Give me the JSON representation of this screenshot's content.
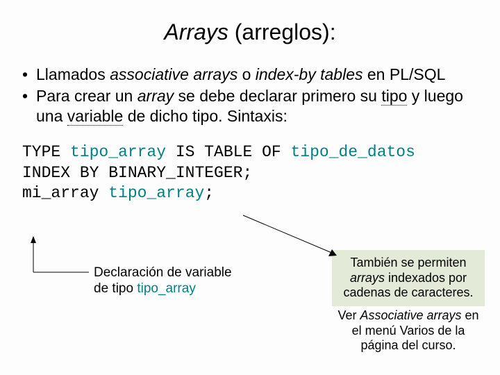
{
  "title": {
    "ital": "Arrays",
    "rest": " (arreglos):"
  },
  "bullets": {
    "b1": {
      "pre": "Llamados ",
      "i1": "associative arrays",
      "mid": " o ",
      "i2": "index-by tables",
      "post": " en PL/SQL"
    },
    "b2": {
      "pre": "Para crear un ",
      "i1": "array",
      "mid1": " se debe declarar primero su ",
      "u1": "tipo",
      "mid2": " y luego una ",
      "u2": "variable",
      "post": " de dicho tipo. Sintaxis:"
    }
  },
  "code": {
    "l1a": "TYPE ",
    "l1b": "tipo_array",
    "l1c": " IS TABLE OF ",
    "l1d": "tipo_de_datos",
    "l2": "INDEX BY BINARY_INTEGER;",
    "l3a": "mi_array ",
    "l3b": "tipo_array",
    "l3c": ";"
  },
  "anno1": {
    "l1": "Declaración de variable",
    "l2a": "de tipo ",
    "l2b": "tipo_array"
  },
  "box2": {
    "l1a": "También se permiten ",
    "l1b": "arrays",
    "l1c": " indexados por cadenas de caracteres."
  },
  "box3": {
    "l1a": "Ver ",
    "l1b": "Associative arrays",
    "l1c": " en el menú Varios de la página del curso."
  }
}
